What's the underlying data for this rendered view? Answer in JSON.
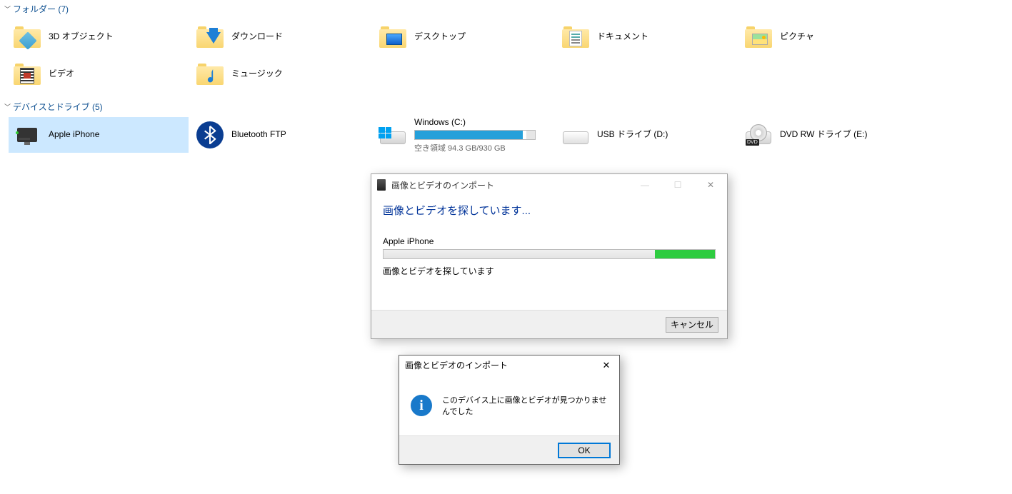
{
  "sections": {
    "folders": {
      "title": "フォルダー (7)"
    },
    "drives": {
      "title": "デバイスとドライブ (5)"
    }
  },
  "folders": [
    {
      "label": "3D オブジェクト"
    },
    {
      "label": "ダウンロード"
    },
    {
      "label": "デスクトップ"
    },
    {
      "label": "ドキュメント"
    },
    {
      "label": "ピクチャ"
    },
    {
      "label": "ビデオ"
    },
    {
      "label": "ミュージック"
    }
  ],
  "drives": [
    {
      "label": "Apple iPhone",
      "selected": true
    },
    {
      "label": "Bluetooth FTP"
    },
    {
      "name": "Windows (C:)",
      "space": "空き領域 94.3 GB/930 GB",
      "used_percent": 90
    },
    {
      "label": "USB ドライブ (D:)"
    },
    {
      "label": "DVD RW ドライブ (E:)"
    }
  ],
  "dialog1": {
    "title": "画像とビデオのインポート",
    "heading": "画像とビデオを探しています...",
    "device": "Apple iPhone",
    "status": "画像とビデオを探しています",
    "cancel": "キャンセル"
  },
  "dialog2": {
    "title": "画像とビデオのインポート",
    "message": "このデバイス上に画像とビデオが見つかりませんでした",
    "ok": "OK"
  }
}
